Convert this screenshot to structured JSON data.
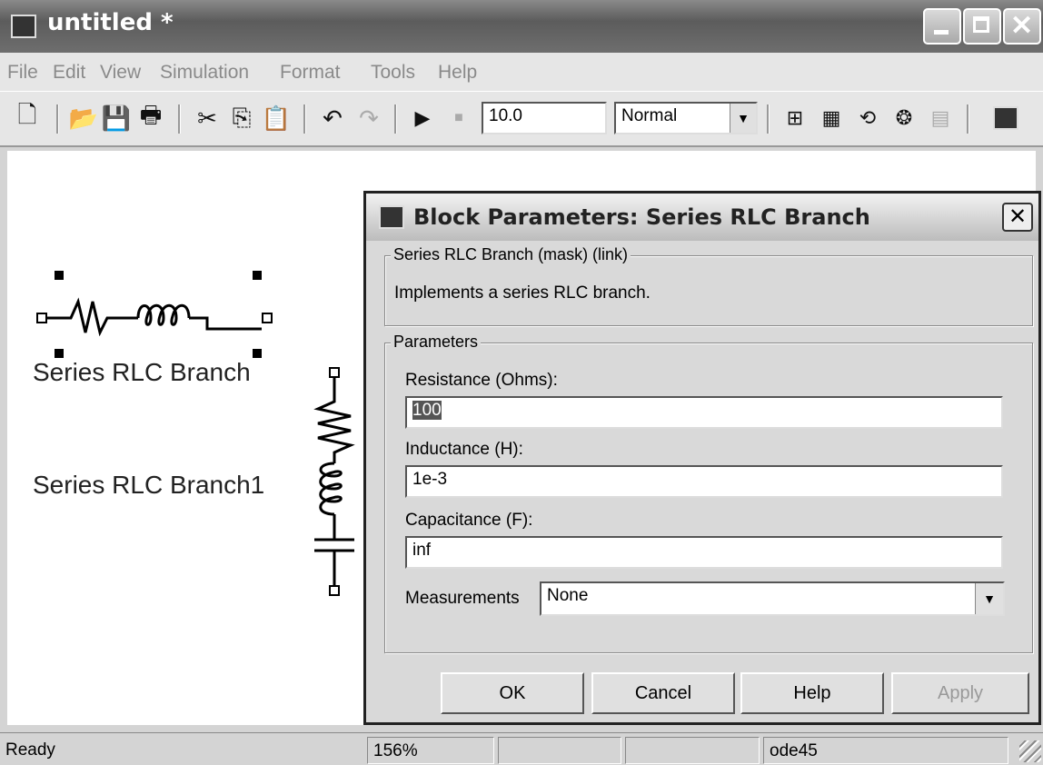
{
  "window": {
    "title": "untitled *"
  },
  "menu": [
    "File",
    "Edit",
    "View",
    "Simulation",
    "Format",
    "Tools",
    "Help"
  ],
  "toolbar": {
    "stop_time": "10.0",
    "sim_mode": "Normal"
  },
  "canvas": {
    "block1_label": "Series RLC Branch",
    "block2_label": "Series RLC Branch1"
  },
  "dialog": {
    "title": "Block Parameters: Series RLC Branch",
    "group1_title": "Series RLC Branch (mask) (link)",
    "description": "Implements a series RLC branch.",
    "group2_title": "Parameters",
    "resistance_label": "Resistance (Ohms):",
    "resistance_value": "100",
    "inductance_label": "Inductance (H):",
    "inductance_value": "1e-3",
    "capacitance_label": "Capacitance (F):",
    "capacitance_value": "inf",
    "measurements_label": "Measurements",
    "measurements_value": "None",
    "buttons": {
      "ok": "OK",
      "cancel": "Cancel",
      "help": "Help",
      "apply": "Apply"
    }
  },
  "status": {
    "ready": "Ready",
    "zoom": "156%",
    "solver": "ode45"
  }
}
